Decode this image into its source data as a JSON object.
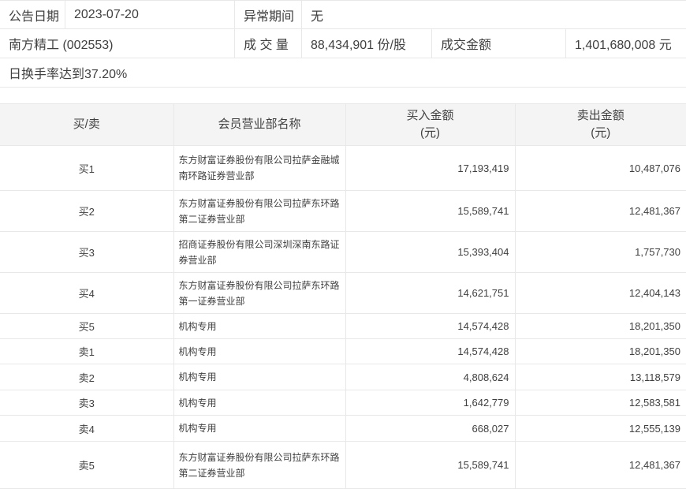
{
  "info": {
    "announce_label": "公告日期",
    "announce_date": "2023-07-20",
    "abnormal_label": "异常期间",
    "abnormal_value": "无",
    "stock_name": "南方精工 (002553)",
    "volume_label": "成 交 量",
    "volume_value": "88,434,901 份/股",
    "amount_label": "成交金额",
    "amount_value": "1,401,680,008 元",
    "turnover_note": "日换手率达到37.20%"
  },
  "table": {
    "headers": {
      "side": "买/卖",
      "branch": "会员营业部名称",
      "buy": "买入金额",
      "sell": "卖出金额",
      "unit": "(元)"
    },
    "rows": [
      {
        "side": "买1",
        "branch": "东方财富证券股份有限公司拉萨金融城南环路证券营业部",
        "buy": "17,193,419",
        "sell": "10,487,076"
      },
      {
        "side": "买2",
        "branch": "东方财富证券股份有限公司拉萨东环路第二证券营业部",
        "buy": "15,589,741",
        "sell": "12,481,367"
      },
      {
        "side": "买3",
        "branch": "招商证券股份有限公司深圳深南东路证券营业部",
        "buy": "15,393,404",
        "sell": "1,757,730"
      },
      {
        "side": "买4",
        "branch": "东方财富证券股份有限公司拉萨东环路第一证券营业部",
        "buy": "14,621,751",
        "sell": "12,404,143"
      },
      {
        "side": "买5",
        "branch": "机构专用",
        "buy": "14,574,428",
        "sell": "18,201,350"
      },
      {
        "side": "卖1",
        "branch": "机构专用",
        "buy": "14,574,428",
        "sell": "18,201,350"
      },
      {
        "side": "卖2",
        "branch": "机构专用",
        "buy": "4,808,624",
        "sell": "13,118,579"
      },
      {
        "side": "卖3",
        "branch": "机构专用",
        "buy": "1,642,779",
        "sell": "12,583,581"
      },
      {
        "side": "卖4",
        "branch": "机构专用",
        "buy": "668,027",
        "sell": "12,555,139"
      },
      {
        "side": "卖5",
        "branch": "东方财富证券股份有限公司拉萨东环路第二证券营业部",
        "buy": "15,589,741",
        "sell": "12,481,367"
      }
    ]
  },
  "colors": {
    "header_bg": "#f4f4f4",
    "border": "#e8e8e8",
    "text": "#404040",
    "page_bg": "#ffffff"
  }
}
